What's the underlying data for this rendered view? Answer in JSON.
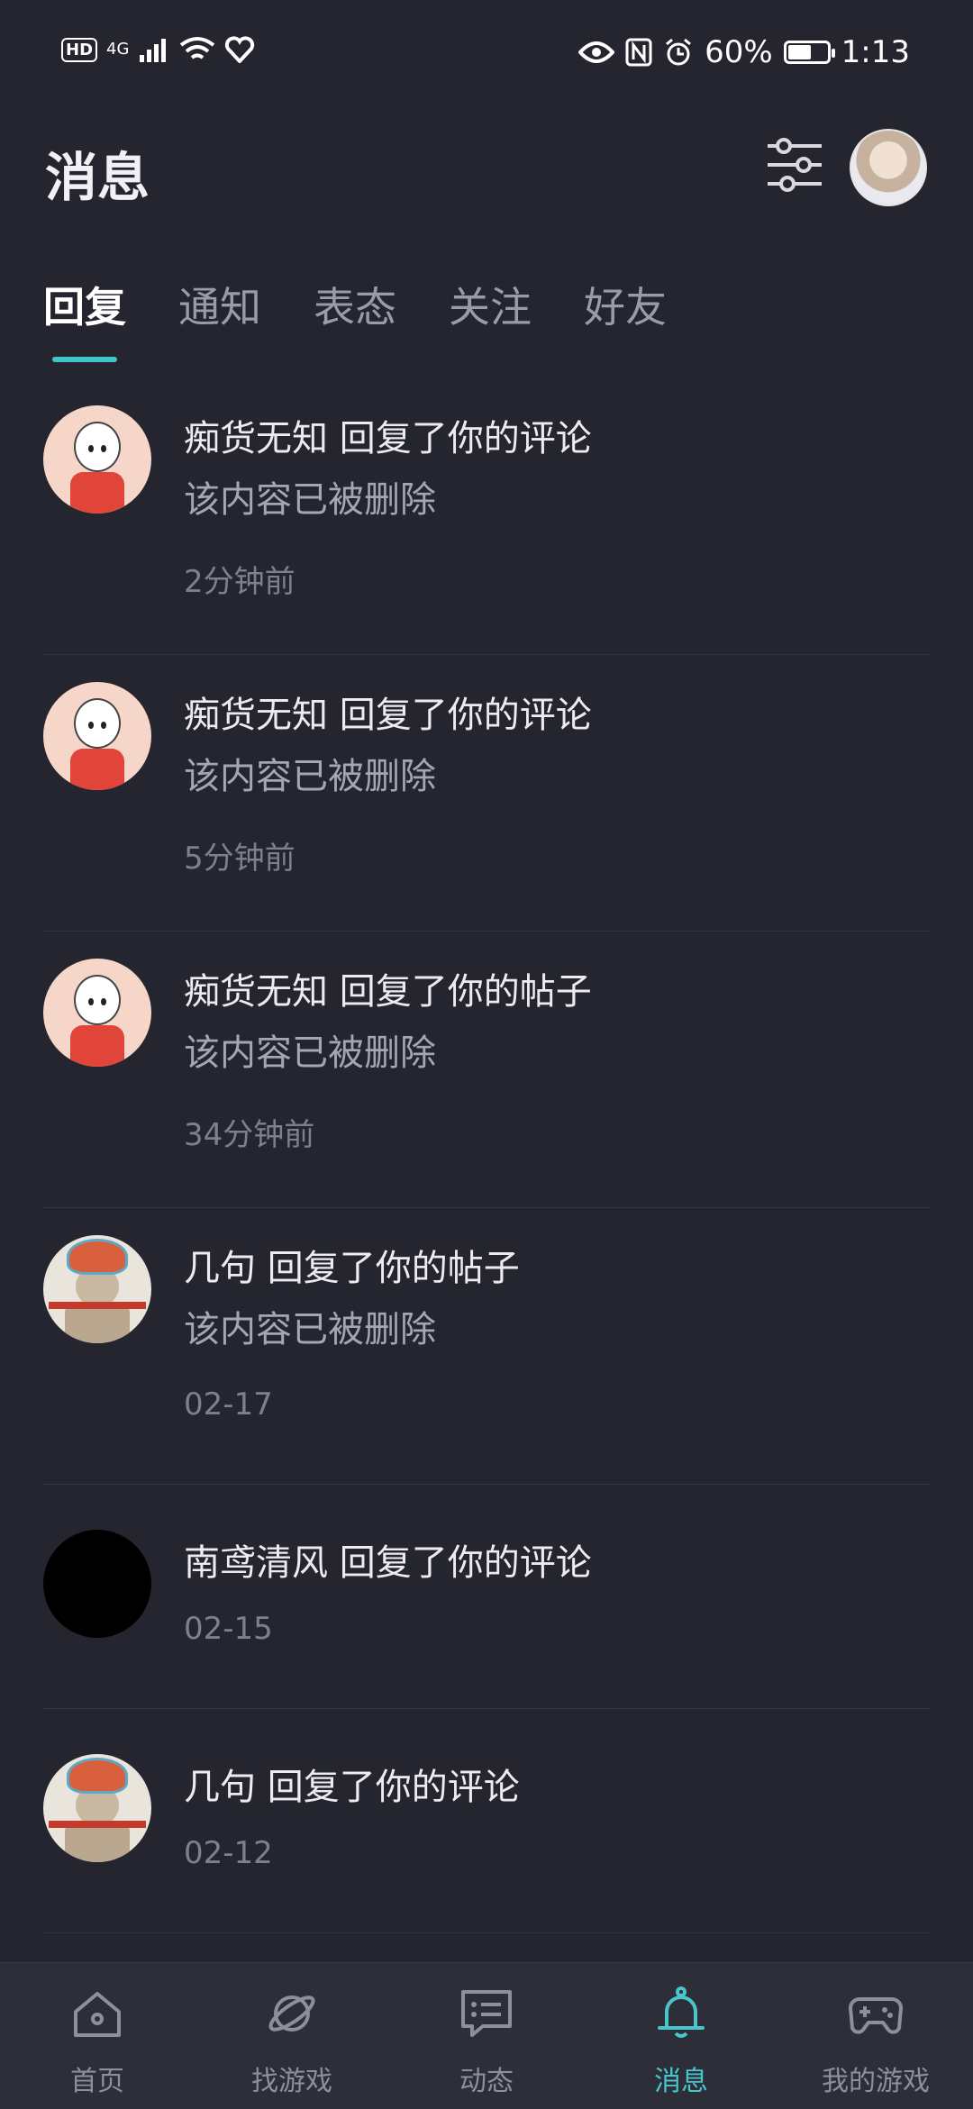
{
  "status_bar": {
    "hd": "HD",
    "network": "4G",
    "battery_percent": "60%",
    "battery_level": 0.6,
    "time": "1:13"
  },
  "header": {
    "title": "消息",
    "filter_icon": "filter-sliders-icon"
  },
  "tabs": [
    {
      "label": "回复",
      "active": true
    },
    {
      "label": "通知",
      "active": false
    },
    {
      "label": "表态",
      "active": false
    },
    {
      "label": "关注",
      "active": false
    },
    {
      "label": "好友",
      "active": false
    }
  ],
  "messages": [
    {
      "title": "痴货无知 回复了你的评论",
      "content": "该内容已被删除",
      "time": "2分钟前",
      "avatar": "baby"
    },
    {
      "title": "痴货无知 回复了你的评论",
      "content": "该内容已被删除",
      "time": "5分钟前",
      "avatar": "baby"
    },
    {
      "title": "痴货无知 回复了你的帖子",
      "content": "该内容已被删除",
      "time": "34分钟前",
      "avatar": "baby"
    },
    {
      "title": "几句 回复了你的帖子",
      "content": "该内容已被删除",
      "time": "02-17",
      "avatar": "lion"
    },
    {
      "title": "南鸢清风 回复了你的评论",
      "content": "",
      "time": "02-15",
      "avatar": "black"
    },
    {
      "title": "几句 回复了你的评论",
      "content": "",
      "time": "02-12",
      "avatar": "lion"
    }
  ],
  "bottom_nav": [
    {
      "label": "首页",
      "icon": "home-icon",
      "active": false
    },
    {
      "label": "找游戏",
      "icon": "planet-icon",
      "active": false
    },
    {
      "label": "动态",
      "icon": "chat-icon",
      "active": false
    },
    {
      "label": "消息",
      "icon": "bell-icon",
      "active": true
    },
    {
      "label": "我的游戏",
      "icon": "gamepad-icon",
      "active": false
    }
  ],
  "colors": {
    "background": "#24252f",
    "accent": "#49c6ca",
    "nav_background": "#2d2e38"
  }
}
